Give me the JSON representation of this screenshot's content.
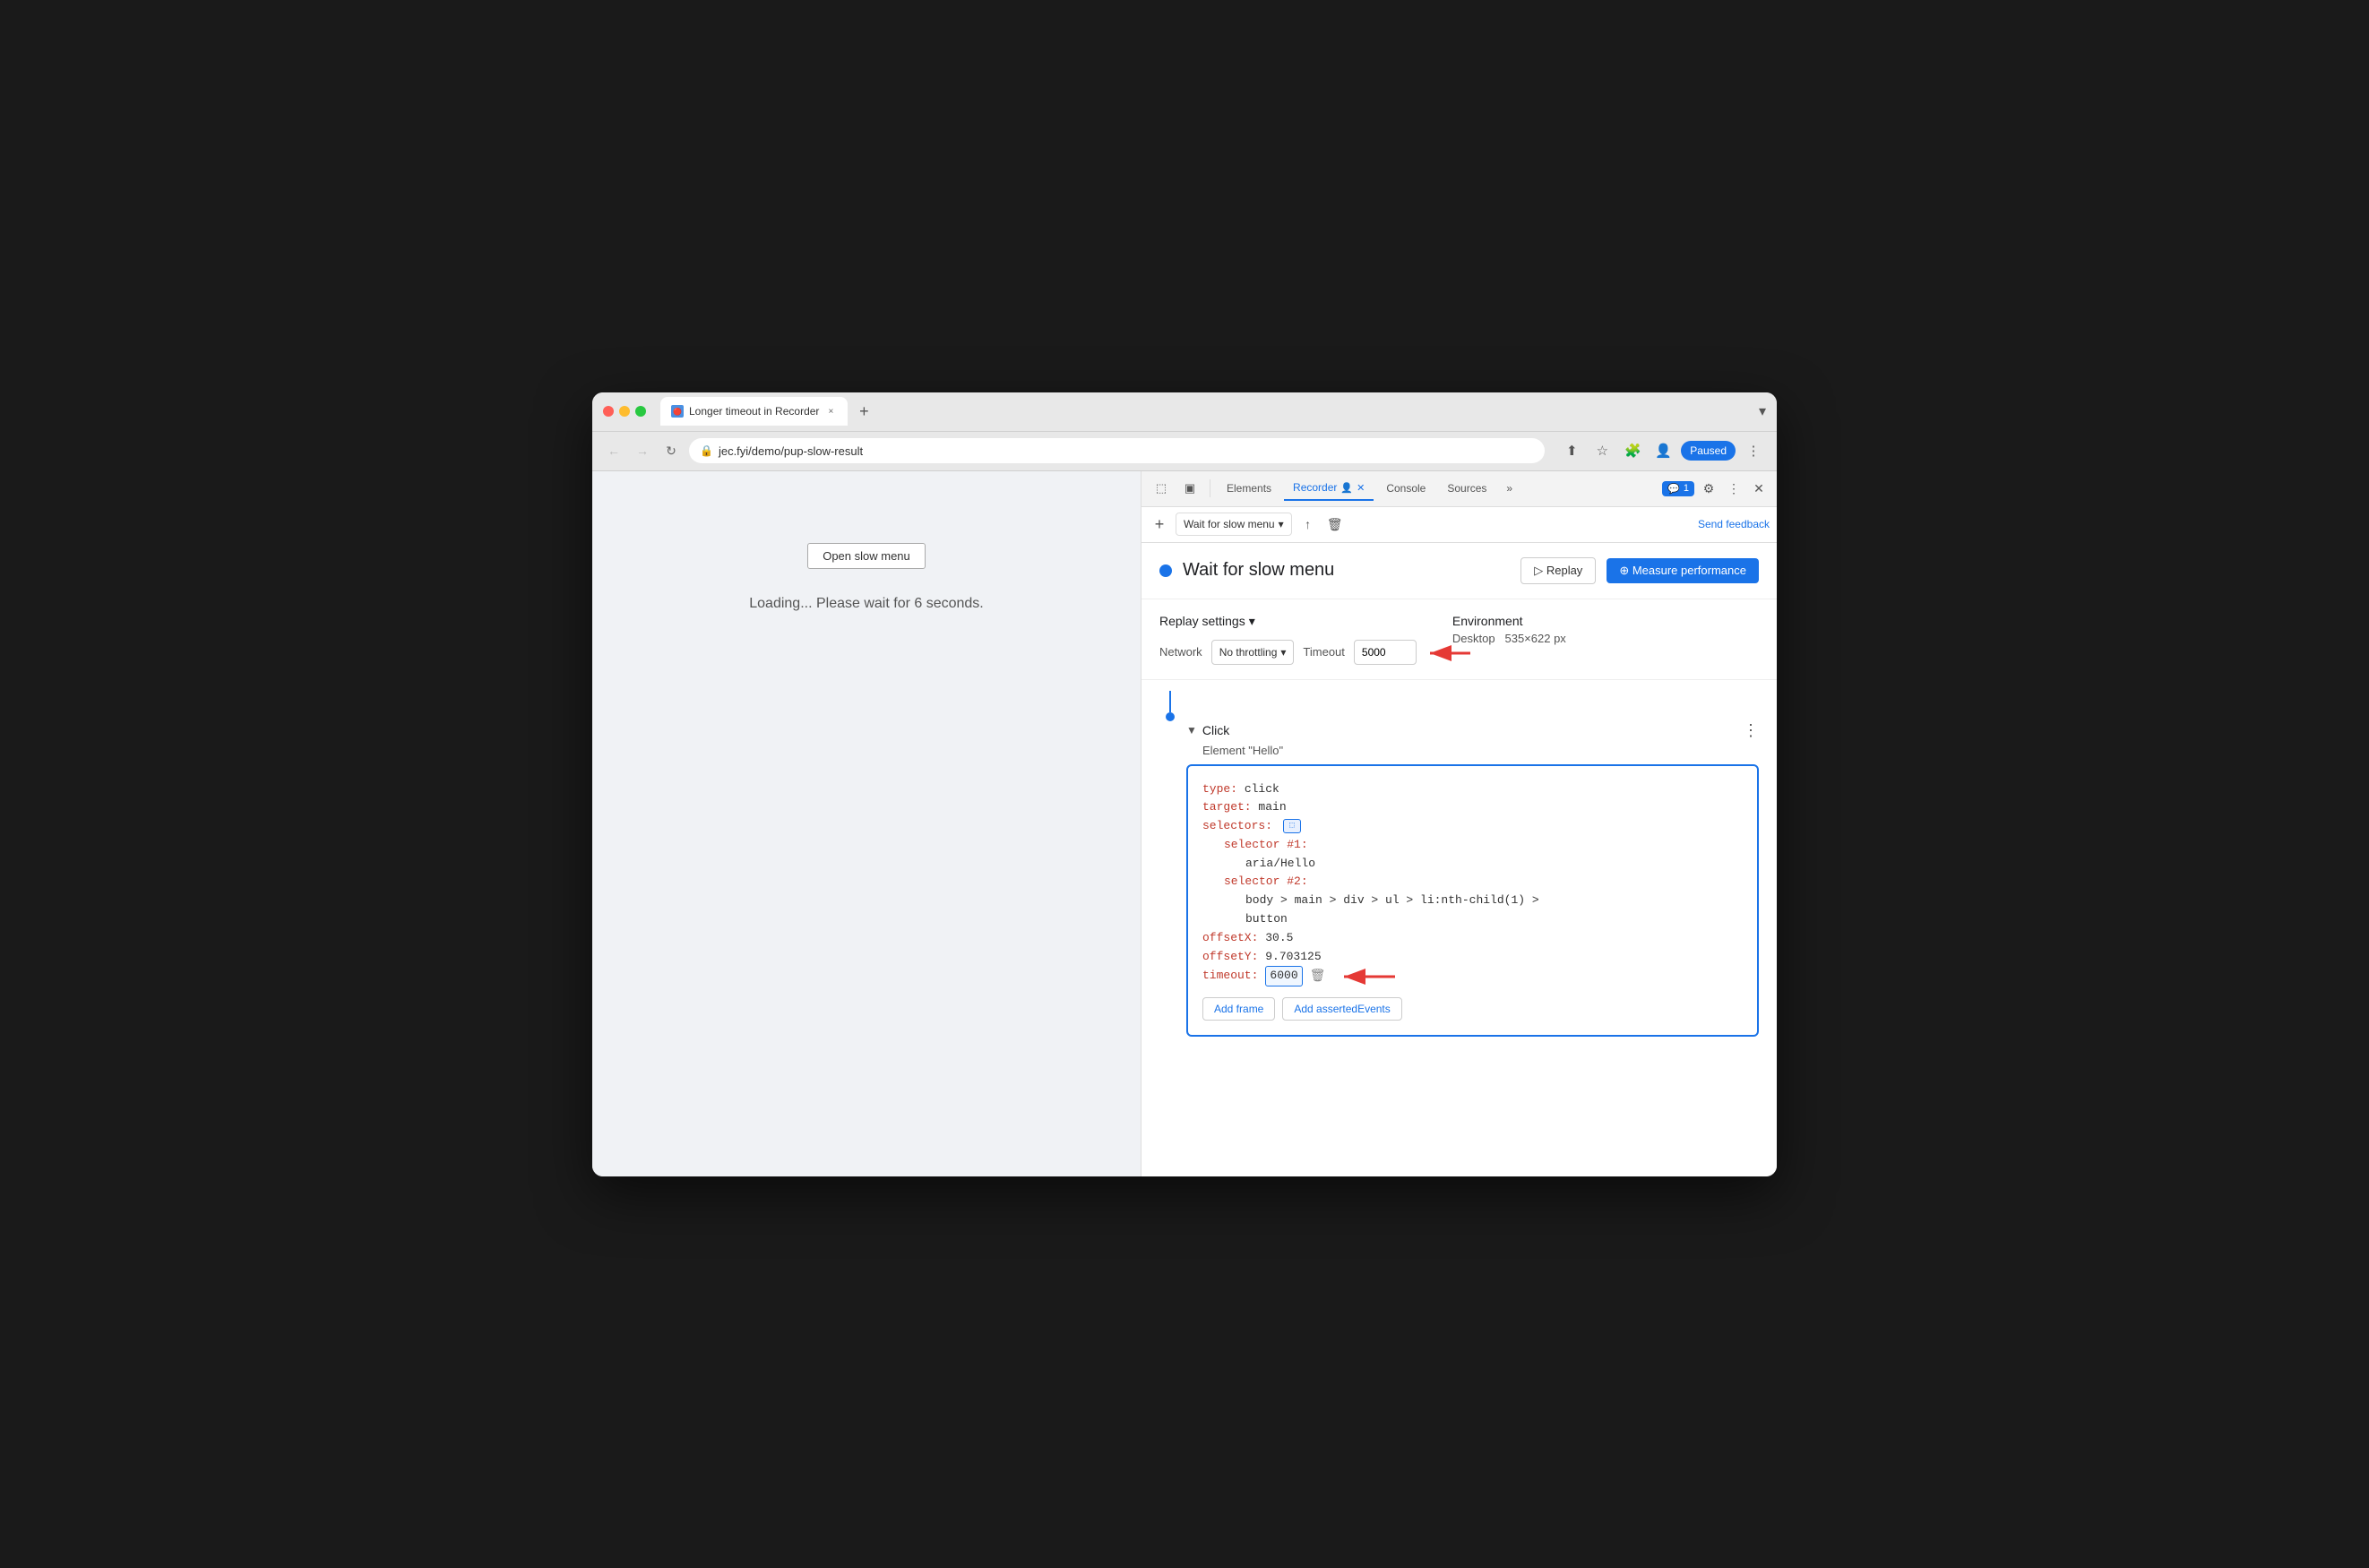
{
  "browser": {
    "tab_title": "Longer timeout in Recorder",
    "tab_close": "×",
    "new_tab": "+",
    "url": "jec.fyi/demo/pup-slow-result",
    "paused_label": "Paused",
    "chevron": "▾"
  },
  "devtools": {
    "tabs": [
      {
        "id": "elements",
        "label": "Elements",
        "active": false
      },
      {
        "id": "recorder",
        "label": "Recorder",
        "active": true
      },
      {
        "id": "console",
        "label": "Console",
        "active": false
      },
      {
        "id": "sources",
        "label": "Sources",
        "active": false
      }
    ],
    "more": "»",
    "chat_badge": "1",
    "send_feedback": "Send feedback"
  },
  "recorder": {
    "add_btn": "+",
    "recording_name": "Wait for slow menu",
    "export_icon": "↑",
    "delete_icon": "🗑",
    "title": "Wait for slow menu",
    "dot_color": "#1a73e8",
    "replay_btn": "▷ Replay",
    "measure_btn": "⊕ Measure performance"
  },
  "replay_settings": {
    "title": "Replay settings",
    "network_label": "Network",
    "network_value": "No throttling",
    "timeout_label": "Timeout",
    "timeout_value": "5000",
    "environment_title": "Environment",
    "environment_value": "Desktop",
    "environment_size": "535×622 px"
  },
  "step": {
    "type": "Click",
    "description": "Element \"Hello\"",
    "code": {
      "type_key": "type:",
      "type_val": " click",
      "target_key": "target:",
      "target_val": " main",
      "selectors_key": "selectors:",
      "selector1_key": "selector #1:",
      "selector1_val": "aria/Hello",
      "selector2_key": "selector #2:",
      "selector2_val": "body > main > div > ul > li:nth-child(1) >",
      "selector2_val2": "button",
      "offsetX_key": "offsetX:",
      "offsetX_val": " 30.5",
      "offsetY_key": "offsetY:",
      "offsetY_val": " 9.703125",
      "timeout_key": "timeout:",
      "timeout_val": " 6000"
    },
    "add_frame_btn": "Add frame",
    "add_asserted_btn": "Add assertedEvents"
  },
  "page": {
    "open_menu_btn": "Open slow menu",
    "loading_text": "Loading... Please wait for 6 seconds."
  }
}
